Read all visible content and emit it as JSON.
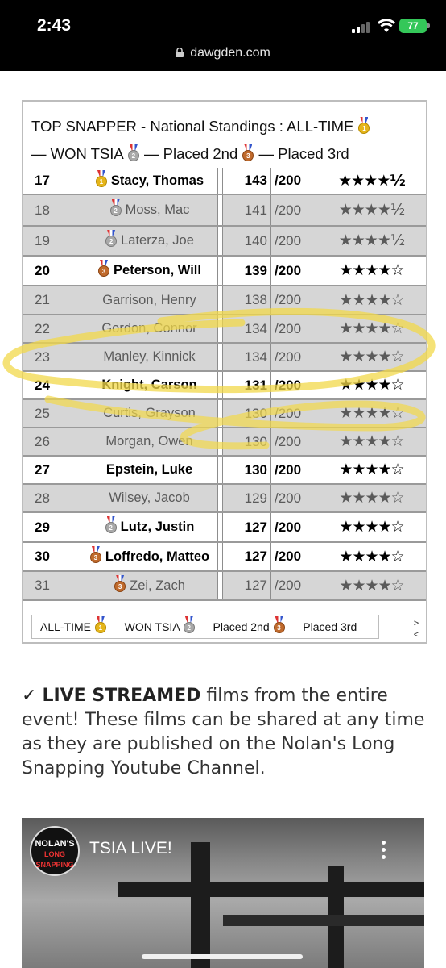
{
  "status_bar": {
    "time": "2:43",
    "battery": "77"
  },
  "browser": {
    "url": "dawgden.com"
  },
  "standings": {
    "title_line1": "TOP SNAPPER - National Standings : ALL-TIME",
    "title_line2_won": "— WON TSIA",
    "title_line2_second": "— Placed 2nd",
    "title_line2_third": "— Placed 3rd",
    "rows": [
      {
        "rank": "17",
        "name": "Stacy, Thomas",
        "medal": "gold",
        "score": "143",
        "max": "/200",
        "stars": "★★★★½",
        "style": "bold"
      },
      {
        "rank": "18",
        "name": "Moss, Mac",
        "medal": "silver",
        "score": "141",
        "max": "/200",
        "stars": "★★★★½",
        "style": "dim"
      },
      {
        "rank": "19",
        "name": "Laterza, Joe",
        "medal": "silver",
        "score": "140",
        "max": "/200",
        "stars": "★★★★½",
        "style": "dim"
      },
      {
        "rank": "20",
        "name": "Peterson, Will",
        "medal": "bronze",
        "score": "139",
        "max": "/200",
        "stars": "★★★★☆",
        "style": "bold"
      },
      {
        "rank": "21",
        "name": "Garrison, Henry",
        "medal": "",
        "score": "138",
        "max": "/200",
        "stars": "★★★★☆",
        "style": "dim"
      },
      {
        "rank": "22",
        "name": "Gordon, Connor",
        "medal": "",
        "score": "134",
        "max": "/200",
        "stars": "★★★★☆",
        "style": "dim"
      },
      {
        "rank": "23",
        "name": "Manley, Kinnick",
        "medal": "",
        "score": "134",
        "max": "/200",
        "stars": "★★★★☆",
        "style": "dim"
      },
      {
        "rank": "24",
        "name": "Knight, Carson",
        "medal": "",
        "score": "131",
        "max": "/200",
        "stars": "★★★★☆",
        "style": "bold"
      },
      {
        "rank": "25",
        "name": "Curtis, Grayson",
        "medal": "",
        "score": "130",
        "max": "/200",
        "stars": "★★★★☆",
        "style": "dim"
      },
      {
        "rank": "26",
        "name": "Morgan, Owen",
        "medal": "",
        "score": "130",
        "max": "/200",
        "stars": "★★★★☆",
        "style": "dim"
      },
      {
        "rank": "27",
        "name": "Epstein, Luke",
        "medal": "",
        "score": "130",
        "max": "/200",
        "stars": "★★★★☆",
        "style": "bold"
      },
      {
        "rank": "28",
        "name": "Wilsey, Jacob",
        "medal": "",
        "score": "129",
        "max": "/200",
        "stars": "★★★★☆",
        "style": "dim"
      },
      {
        "rank": "29",
        "name": "Lutz, Justin",
        "medal": "silver",
        "score": "127",
        "max": "/200",
        "stars": "★★★★☆",
        "style": "bold"
      },
      {
        "rank": "30",
        "name": "Loffredo, Matteo",
        "medal": "bronze",
        "score": "127",
        "max": "/200",
        "stars": "★★★★☆",
        "style": "bold"
      },
      {
        "rank": "31",
        "name": "Zei, Zach",
        "medal": "bronze",
        "score": "127",
        "max": "/200",
        "stars": "★★★★☆",
        "style": "dim"
      }
    ],
    "legend": {
      "alltime": "ALL-TIME",
      "won": "— WON TSIA",
      "second": "— Placed 2nd",
      "third": "— Placed 3rd"
    },
    "scroll_next": ">",
    "scroll_prev": "<"
  },
  "article": {
    "check": "✓",
    "bold": "LIVE STREAMED",
    "text": " films from the entire event! These films can be shared at any time as they are published on the Nolan's Long Snapping Youtube Channel."
  },
  "video": {
    "title": "TSIA LIVE!",
    "channel_logo_line1": "NOLAN'S",
    "channel_logo_line2": "LONG SNAPPING"
  },
  "colors": {
    "highlight_marker": "#f2d84a",
    "gold": "#e5b51a",
    "silver": "#a9a9a9",
    "bronze": "#c06a2c",
    "battery": "#34c759"
  }
}
